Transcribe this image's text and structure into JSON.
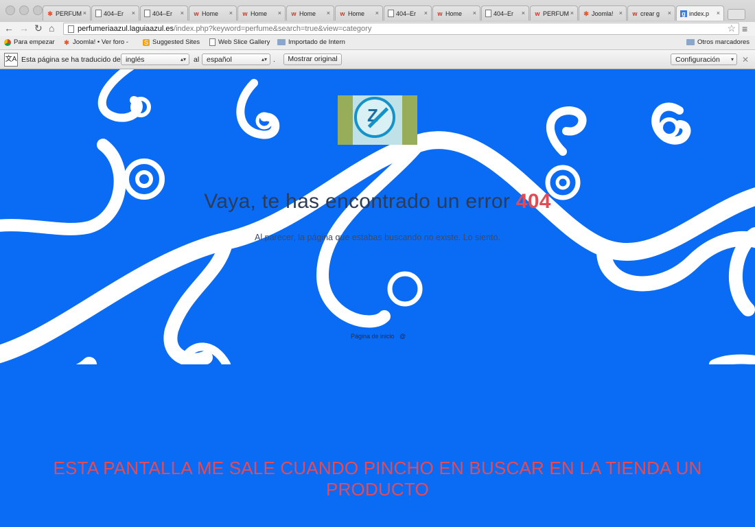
{
  "browser": {
    "tabs": [
      {
        "label": "PERFUM",
        "icon": "joomla-icon"
      },
      {
        "label": "404–Er",
        "icon": "page-icon"
      },
      {
        "label": "404–Er",
        "icon": "page-icon"
      },
      {
        "label": "Home",
        "icon": "w-icon"
      },
      {
        "label": "Home",
        "icon": "w-icon"
      },
      {
        "label": "Home",
        "icon": "w-icon"
      },
      {
        "label": "Home",
        "icon": "w-icon"
      },
      {
        "label": "404–Er",
        "icon": "page-icon"
      },
      {
        "label": "Home",
        "icon": "w-icon"
      },
      {
        "label": "404–Er",
        "icon": "page-icon"
      },
      {
        "label": "PERFUM",
        "icon": "w-icon"
      },
      {
        "label": "Joomla!",
        "icon": "joomla-icon"
      },
      {
        "label": "crear g",
        "icon": "w-icon"
      },
      {
        "label": "index.p",
        "icon": "g-icon"
      }
    ],
    "close_glyph": "×",
    "url_host": "perfumeriaazul.laguiaazul.es",
    "url_path": "/index.php?keyword=perfume&search=true&view=category",
    "bookmarks": [
      {
        "label": "Para empezar",
        "icon": "chrome-icon"
      },
      {
        "label": "Joomla! • Ver foro -",
        "icon": "joomla-icon"
      },
      {
        "label": "Suggested Sites",
        "icon": "suggested-icon"
      },
      {
        "label": "Web Slice Gallery",
        "icon": "page-icon"
      },
      {
        "label": "Importado de Intern",
        "icon": "folder-icon"
      }
    ],
    "other_bookmarks": "Otros marcadores",
    "translate": {
      "text_before": "Esta página se ha traducido del",
      "from_lang": "inglés",
      "text_middle": "al",
      "to_lang": "español",
      "text_after": ".",
      "show_original": "Mostrar original",
      "settings": "Configuración"
    }
  },
  "page": {
    "title_text": "Vaya, te has encontrado un error",
    "title_code": "404",
    "subtitle": "Al parecer, la página que estabas buscando no existe. Lo siento.",
    "home_link": "Página de inicio",
    "home_icon_glyph": "@",
    "caption": "ESTA PANTALLA  ME SALE CUANDO PINCHO EN BUSCAR EN LA TIENDA UN PRODUCTO",
    "colors": {
      "background": "#0a6cf5",
      "error_code": "#e04b55",
      "caption": "#e64a55",
      "swirl": "#ffffff"
    }
  }
}
